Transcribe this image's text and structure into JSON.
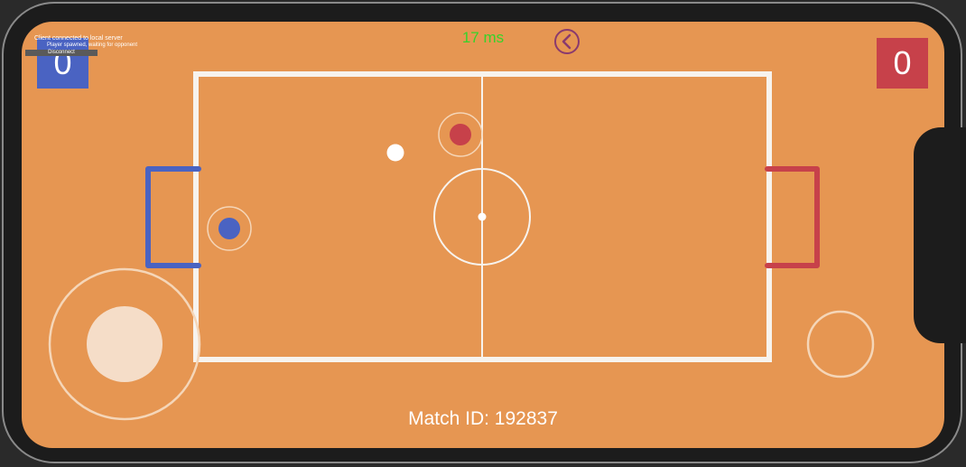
{
  "hud": {
    "blue_score": "0",
    "red_score": "0",
    "ping": "17 ms",
    "match_id": "Match ID: 192837",
    "debug_line1": "Client connected to local server",
    "debug_line2": "Player spawned, waiting for opponent",
    "debug_button": "Disconnect"
  },
  "colors": {
    "field": "#e69652",
    "lines": "#f7f3ee",
    "blue_team": "#4a63c2",
    "red_team": "#c7414a",
    "ping": "#35d42a",
    "back_button": "#8a3a6e"
  },
  "icons": {
    "back": "chevron-left-circle-icon"
  }
}
